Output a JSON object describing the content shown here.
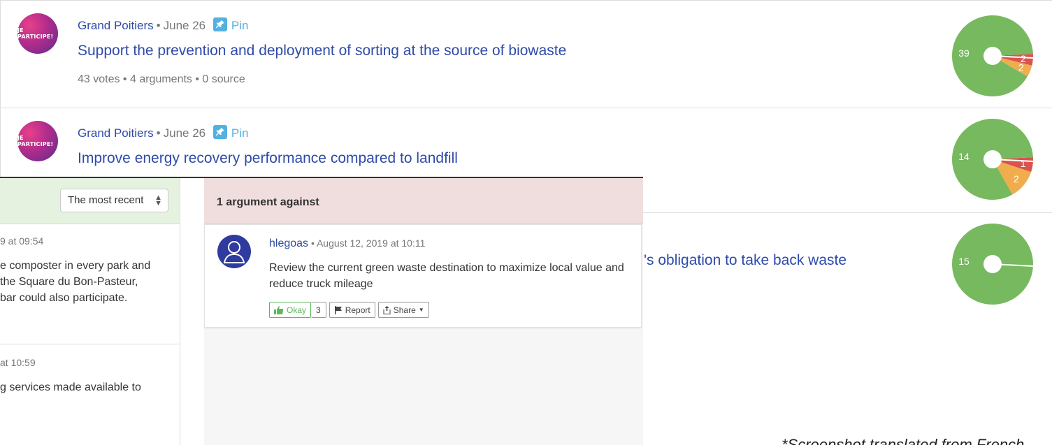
{
  "proposals": [
    {
      "author": "Grand Poitiers",
      "date": "June 26",
      "pin_label": "Pin",
      "logo_text": "JE PARTICIPE!",
      "title": "Support the prevention and deployment of sorting at the source of biowaste",
      "stats": "43 votes • 4 arguments • 0 source",
      "votes": {
        "for": 39,
        "against": 2,
        "mixed": 2
      },
      "vote_labels": {
        "for": "39",
        "against": "2",
        "mixed": "2"
      }
    },
    {
      "author": "Grand Poitiers",
      "date": "June 26",
      "pin_label": "Pin",
      "logo_text": "JE PARTICIPE!",
      "title": "Improve energy recovery performance compared to landfill",
      "votes": {
        "for": 14,
        "against": 1,
        "mixed": 2
      },
      "vote_labels": {
        "for": "14",
        "against": "1",
        "mixed": "2"
      }
    },
    {
      "title_fragment": "'s obligation to take back waste",
      "votes": {
        "for": 15,
        "against": 0,
        "mixed": 0
      },
      "vote_labels": {
        "for": "15"
      }
    }
  ],
  "overlay": {
    "sort_select": {
      "value": "The most recent",
      "arrows": "▲▼"
    },
    "left_items": [
      {
        "timestamp": "9 at 09:54",
        "lines": [
          "e composter in every park and",
          "the Square du Bon-Pasteur,",
          "bar could also participate."
        ]
      },
      {
        "timestamp": "at 10:59",
        "lines": [
          "g services made available to"
        ]
      }
    ],
    "against_header": "1 argument against",
    "argument": {
      "author": "hlegoas",
      "timestamp": "August 12, 2019 at 10:11",
      "body": "Review the current green waste destination to maximize local value and reduce truck mileage",
      "okay_label": "Okay",
      "okay_count": "3",
      "report_label": "Report",
      "share_label": "Share"
    }
  },
  "footnote": "*Screenshot translated from French",
  "colors": {
    "for": "#77b95f",
    "against": "#d9534f",
    "mixed": "#f0ad4e",
    "link": "#2e4ba8",
    "pin": "#52b1e0"
  }
}
